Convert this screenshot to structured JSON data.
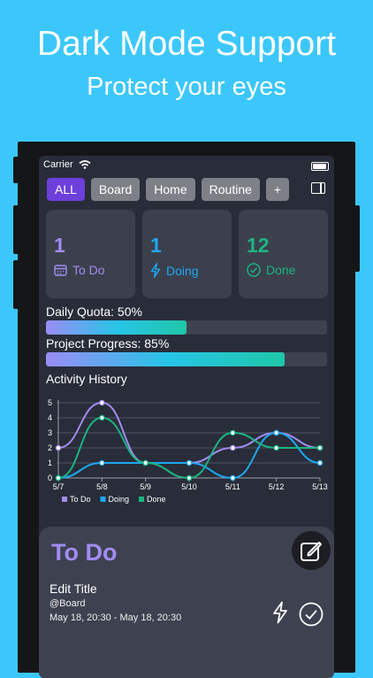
{
  "promo": {
    "title": "Dark Mode Support",
    "subtitle": "Protect your eyes"
  },
  "statusbar": {
    "carrier": "Carrier"
  },
  "tabs": [
    {
      "label": "ALL",
      "active": true
    },
    {
      "label": "Board",
      "active": false
    },
    {
      "label": "Home",
      "active": false
    },
    {
      "label": "Routine",
      "active": false
    },
    {
      "label": "+",
      "active": false
    }
  ],
  "cards": [
    {
      "count": "1",
      "label": "To Do",
      "color": "#a28cf3",
      "icon": "calendar-icon"
    },
    {
      "count": "1",
      "label": "Doing",
      "color": "#1da8f5",
      "icon": "bolt-icon"
    },
    {
      "count": "12",
      "label": "Done",
      "color": "#1bb581",
      "icon": "check-circle-icon"
    }
  ],
  "quota": {
    "label": "Daily Quota: 50%",
    "value": 0.5
  },
  "progress": {
    "label": "Project Progress: 85%",
    "value": 0.85
  },
  "chart_data": {
    "type": "line",
    "title": "Activity History",
    "x": [
      "5/7",
      "5/8",
      "5/9",
      "5/10",
      "5/11",
      "5/12",
      "5/13"
    ],
    "ylim": [
      0,
      5
    ],
    "yticks": [
      "0",
      "1",
      "2",
      "3",
      "4",
      "5"
    ],
    "series": [
      {
        "name": "To Do",
        "color": "#a28cf3",
        "values": [
          2,
          5,
          1,
          1,
          2,
          3,
          2
        ]
      },
      {
        "name": "Doing",
        "color": "#1da8f5",
        "values": [
          0,
          1,
          1,
          1,
          0,
          3,
          1
        ]
      },
      {
        "name": "Done",
        "color": "#1bb581",
        "values": [
          0,
          4,
          1,
          0,
          3,
          2,
          2
        ]
      }
    ],
    "legend": "bottom-left",
    "grid": true
  },
  "todo_panel": {
    "title": "To Do",
    "task": {
      "title": "Edit Title",
      "board": "@Board",
      "dates": "May 18, 20:30 - May 18, 20:30"
    }
  }
}
